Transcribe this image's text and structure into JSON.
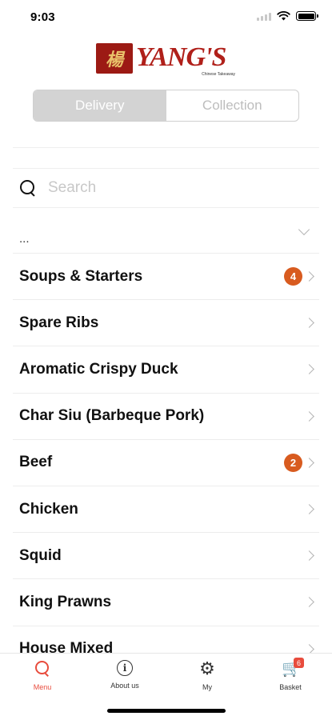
{
  "status_bar": {
    "time": "9:03",
    "icons": [
      "signal-icon",
      "wifi-icon",
      "battery-icon"
    ]
  },
  "logo": {
    "text": "YANG'S",
    "subtitle": "Chinese Takeaway",
    "mark": "楊",
    "colors": {
      "brand": "#b0201a",
      "mark_bg": "#9c1a14"
    }
  },
  "order_mode": {
    "options": [
      "Delivery",
      "Collection"
    ],
    "selected": "Delivery"
  },
  "search": {
    "placeholder": "Search",
    "value": ""
  },
  "filter": {
    "label": "..."
  },
  "categories": [
    {
      "label": "Soups & Starters",
      "badge": "4"
    },
    {
      "label": "Spare Ribs",
      "badge": ""
    },
    {
      "label": "Aromatic Crispy Duck",
      "badge": ""
    },
    {
      "label": "Char Siu (Barbeque Pork)",
      "badge": ""
    },
    {
      "label": "Beef",
      "badge": "2"
    },
    {
      "label": "Chicken",
      "badge": ""
    },
    {
      "label": "Squid",
      "badge": ""
    },
    {
      "label": "King Prawns",
      "badge": ""
    },
    {
      "label": "House Mixed",
      "badge": ""
    }
  ],
  "badge_color": "#d85b1f",
  "tab_bar": {
    "tabs": [
      {
        "label": "Menu",
        "icon": "search-icon",
        "active": true
      },
      {
        "label": "About us",
        "icon": "info-icon",
        "active": false
      },
      {
        "label": "My",
        "icon": "gear-icon",
        "active": false
      },
      {
        "label": "Basket",
        "icon": "cart-icon",
        "active": false,
        "badge": "6"
      }
    ],
    "active_color": "#e84c3d"
  }
}
